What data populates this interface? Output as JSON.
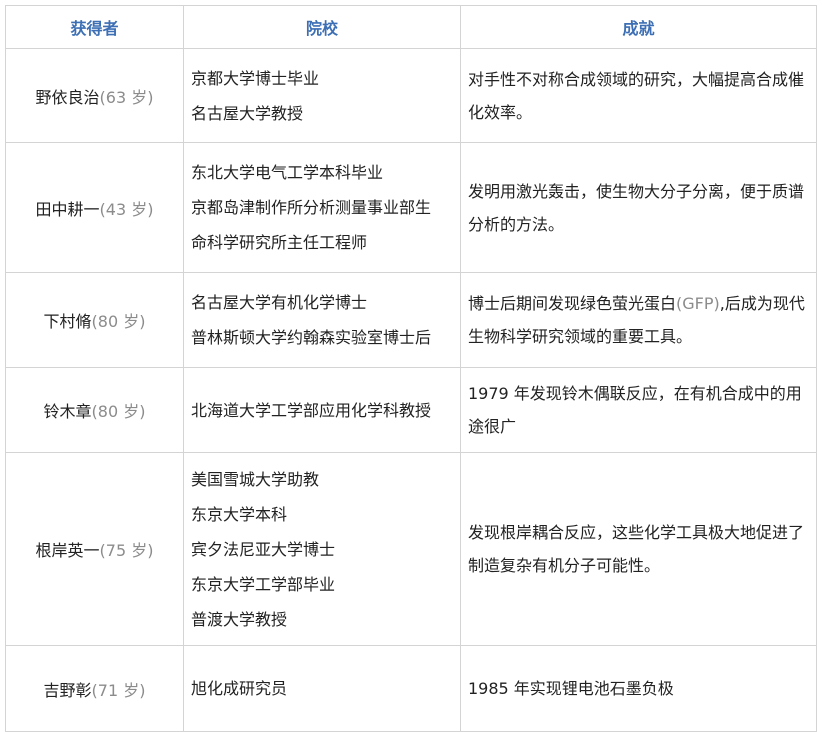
{
  "headers": {
    "winner": "获得者",
    "school": "院校",
    "achievement": "成就"
  },
  "rows": [
    {
      "name": "野依良治",
      "age": "(63 岁)",
      "schools": [
        "京都大学博士毕业",
        "名古屋大学教授"
      ],
      "achievement": "对手性不对称合成领域的研究，大幅提高合成催化效率。"
    },
    {
      "name": "田中耕一",
      "age": "(43 岁)",
      "schools": [
        "东北大学电气工学本科毕业",
        "京都岛津制作所分析测量事业部生",
        "命科学研究所主任工程师"
      ],
      "achievement": "发明用激光轰击，使生物大分子分离，便于质谱分析的方法。"
    },
    {
      "name": "下村脩",
      "age": "(80 岁)",
      "schools": [
        "名古屋大学有机化学博士",
        "普林斯顿大学约翰森实验室博士后"
      ],
      "achievement_pre": "博士后期间发现绿色萤光蛋白",
      "achievement_gfp": "(GFP)",
      "achievement_post": ",后成为现代生物科学研究领域的重要工具。"
    },
    {
      "name": "铃木章",
      "age": "(80 岁)",
      "schools": [
        "北海道大学工学部应用化学科教授"
      ],
      "achievement": "1979 年发现铃木偶联反应，在有机合成中的用途很广"
    },
    {
      "name": "根岸英一",
      "age": "(75 岁)",
      "schools": [
        "美国雪城大学助教",
        "东京大学本科",
        "宾夕法尼亚大学博士",
        "东京大学工学部毕业",
        "普渡大学教授"
      ],
      "achievement": "发现根岸耦合反应，这些化学工具极大地促进了制造复杂有机分子可能性。"
    },
    {
      "name": "吉野彰",
      "age": "(71 岁)",
      "schools": [
        "旭化成研究员"
      ],
      "achievement": "1985 年实现锂电池石墨负极"
    }
  ]
}
